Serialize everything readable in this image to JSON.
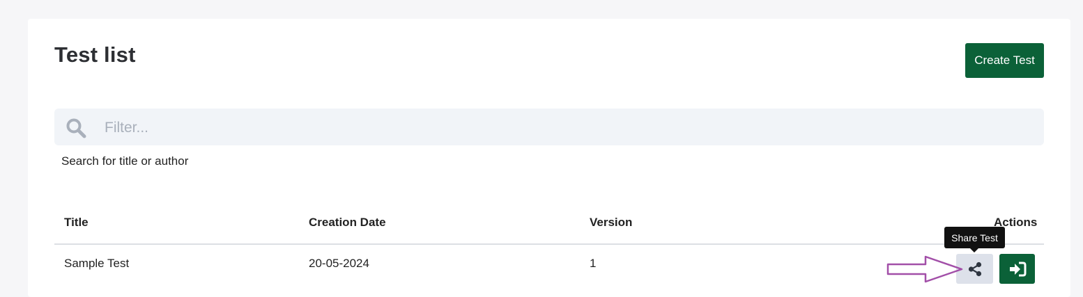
{
  "header": {
    "title": "Test list",
    "create_button_label": "Create Test"
  },
  "search": {
    "placeholder": "Filter...",
    "value": "",
    "hint": "Search for title or author"
  },
  "table": {
    "columns": [
      "Title",
      "Creation Date",
      "Version",
      "Actions"
    ],
    "rows": [
      {
        "title": "Sample Test",
        "creation_date": "20-05-2024",
        "version": "1"
      }
    ]
  },
  "actions": {
    "share_tooltip": "Share Test",
    "share_icon": "share-icon",
    "open_icon": "sign-in-icon"
  },
  "colors": {
    "primary": "#0b6138",
    "share_button_bg": "#dde1ea",
    "annotation_arrow": "#a24fa8",
    "search_bg": "#f1f4f8"
  }
}
